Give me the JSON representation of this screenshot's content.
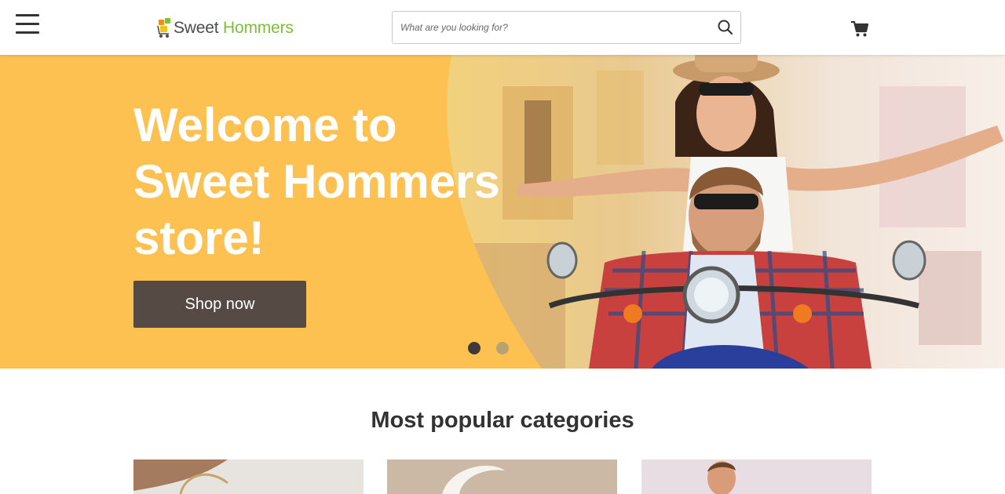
{
  "header": {
    "menu_icon": "hamburger-menu-icon",
    "logo": {
      "word1": "Sweet",
      "word2": "Hommers"
    },
    "search": {
      "placeholder": "What are you looking for?",
      "icon": "search-icon"
    },
    "cart_icon": "shopping-cart-icon"
  },
  "hero": {
    "title": "Welcome to Sweet Hommers store!",
    "cta_label": "Shop now",
    "slides_total": 2,
    "active_slide": 1
  },
  "categories": {
    "title": "Most popular categories",
    "items": [
      {
        "image": "bracelet-photo"
      },
      {
        "image": "moon-decor-photo"
      },
      {
        "image": "man-portrait-photo"
      }
    ]
  },
  "colors": {
    "hero_yellow": "#fcc151",
    "button_brown": "#554a44",
    "logo_green": "#7bbf3a",
    "logo_gray": "#4b4b4b"
  }
}
